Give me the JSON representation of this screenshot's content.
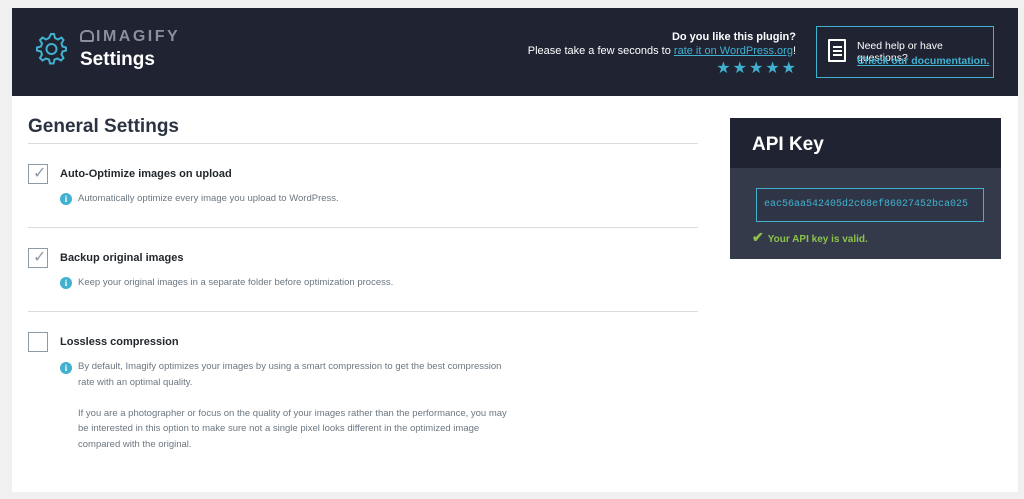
{
  "header": {
    "brand": "IMAGIFY",
    "title": "Settings",
    "rate_question": "Do you like this plugin?",
    "rate_prefix": "Please take a few seconds to ",
    "rate_link": "rate it on WordPress.org",
    "rate_suffix": "!",
    "stars": 5,
    "help_question": "Need help or have questions?",
    "help_link": "Check our documentation."
  },
  "general": {
    "title": "General Settings",
    "options": [
      {
        "label": "Auto-Optimize images on upload",
        "checked": true,
        "desc": "Automatically optimize every image you upload to WordPress."
      },
      {
        "label": "Backup original images",
        "checked": true,
        "desc": "Keep your original images in a separate folder before optimization process."
      },
      {
        "label": "Lossless compression",
        "checked": false,
        "desc_lines": [
          "By default, Imagify optimizes your images by using a smart compression to get the best compression",
          "rate with an optimal quality.",
          "",
          "If you are a photographer or focus on the quality of your images rather than the performance, you may",
          "be interested in this option to make sure not a single pixel looks different in the optimized image",
          "compared with the original."
        ]
      }
    ]
  },
  "api": {
    "title": "API Key",
    "key": "eac56aa542405d2c68ef86027452bca025",
    "valid": "Your API key is valid."
  },
  "colors": {
    "header_bg": "#1f2332",
    "accent": "#40b1d0",
    "valid": "#8bc34a"
  }
}
